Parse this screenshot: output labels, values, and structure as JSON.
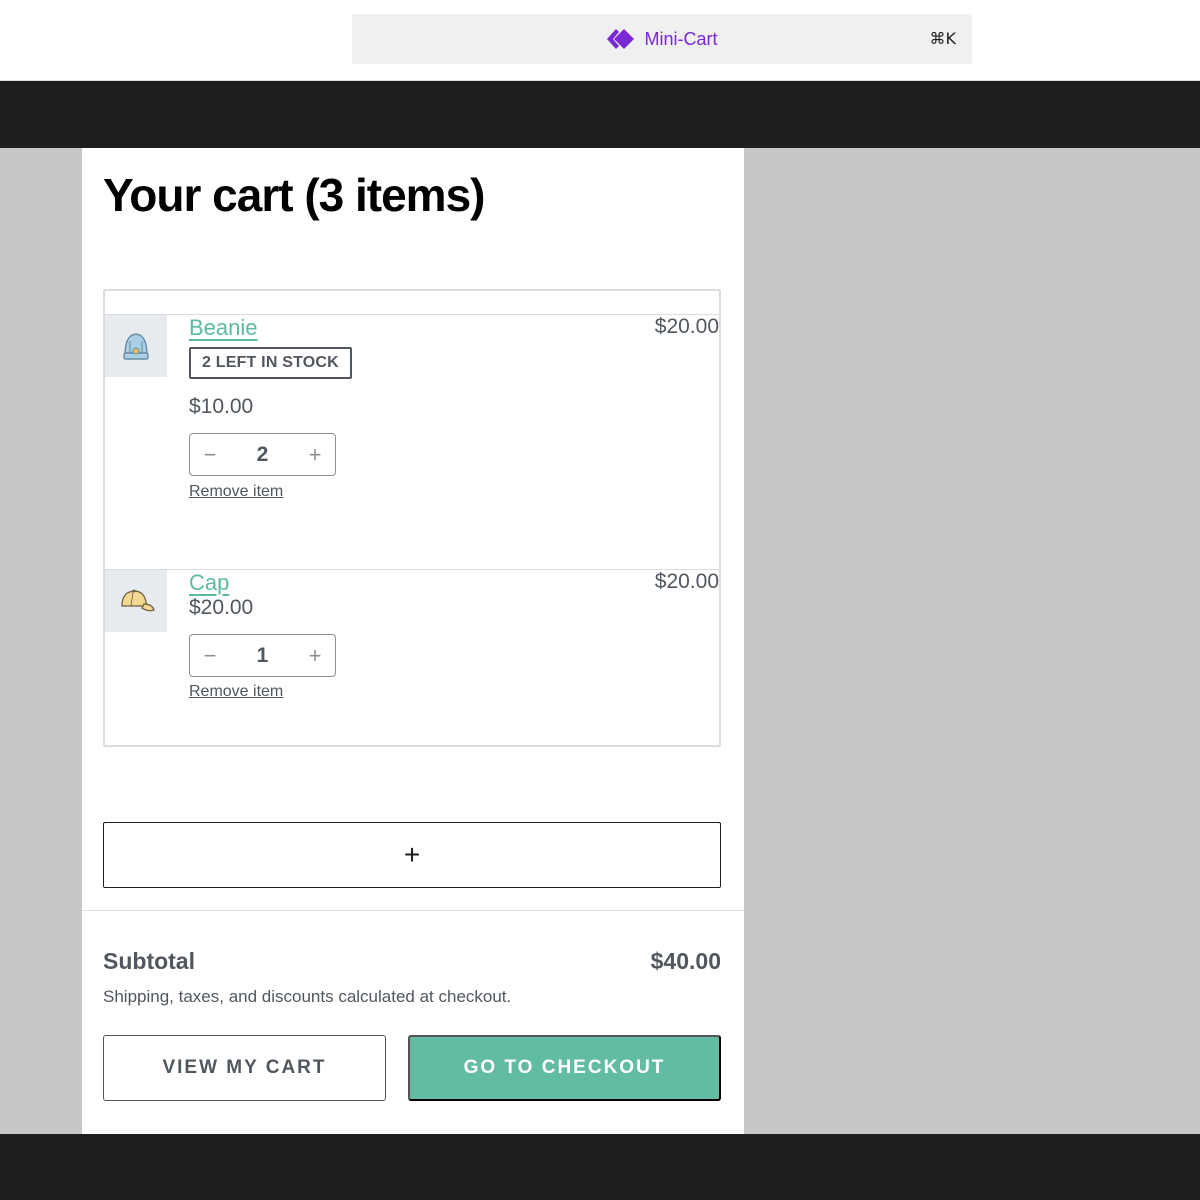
{
  "command_bar": {
    "title": "Mini-Cart",
    "shortcut": "⌘K",
    "icon": "mini-cart-block-icon",
    "accent_color": "#7a27d6"
  },
  "cart": {
    "title": "Your cart (3 items)",
    "items": [
      {
        "name": "Beanie",
        "stock_badge": "2 LEFT IN STOCK",
        "unit_price": "$10.00",
        "quantity": "2",
        "line_total": "$20.00",
        "remove_label": "Remove item",
        "qty_decrease": "−",
        "qty_increase": "+",
        "image_icon": "beanie-icon"
      },
      {
        "name": "Cap",
        "unit_price": "$20.00",
        "quantity": "1",
        "line_total": "$20.00",
        "remove_label": "Remove item",
        "qty_decrease": "−",
        "qty_increase": "+",
        "image_icon": "cap-icon"
      }
    ],
    "add_block_label": "+"
  },
  "footer": {
    "subtotal_label": "Subtotal",
    "subtotal_value": "$40.00",
    "shipping_note": "Shipping, taxes, and discounts calculated at checkout.",
    "view_cart_label": "VIEW MY CART",
    "checkout_label": "GO TO CHECKOUT",
    "checkout_color": "#62bba3",
    "link_color": "#5bbaa1"
  }
}
